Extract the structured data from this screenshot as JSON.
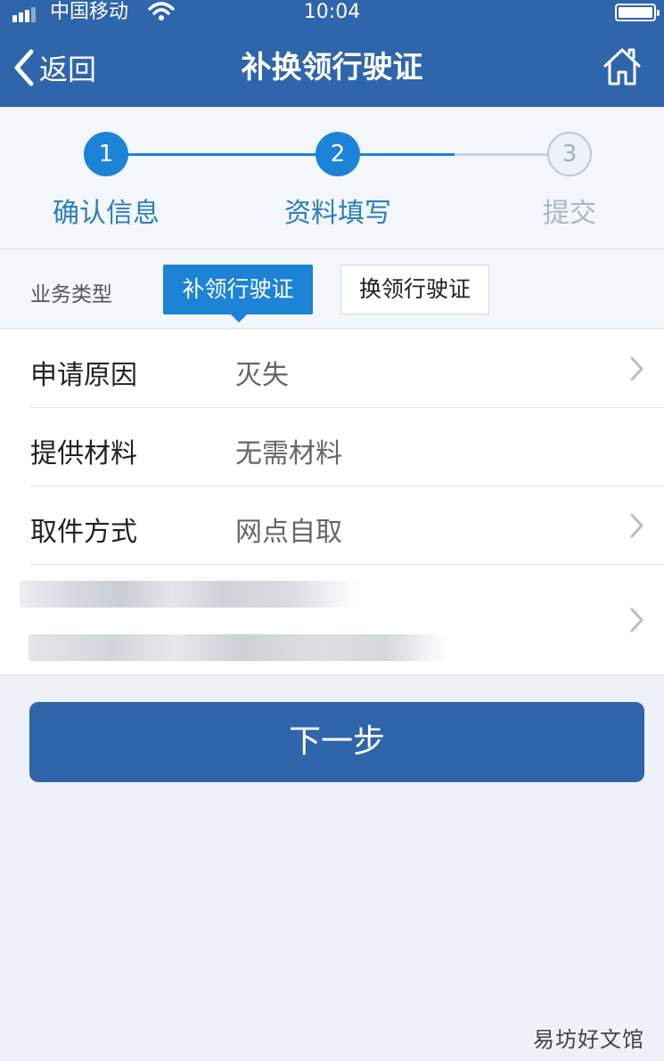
{
  "status_bar": {
    "carrier": "中国移动",
    "time": "10:04"
  },
  "nav": {
    "back_label": "返回",
    "title": "补换领行驶证"
  },
  "steps": [
    {
      "number": "1",
      "label": "确认信息",
      "state": "done"
    },
    {
      "number": "2",
      "label": "资料填写",
      "state": "current"
    },
    {
      "number": "3",
      "label": "提交",
      "state": "pending"
    }
  ],
  "business_type": {
    "label": "业务类型",
    "options": [
      "补领行驶证",
      "换领行驶证"
    ],
    "selected": "补领行驶证"
  },
  "form": {
    "rows": [
      {
        "label": "申请原因",
        "value": "灭失"
      },
      {
        "label": "提供材料",
        "value": "无需材料"
      },
      {
        "label": "取件方式",
        "value": "网点自取"
      }
    ]
  },
  "next_button": "下一步",
  "watermark": "易坊好文馆",
  "colors": {
    "nav": "#2f65aa",
    "accent": "#1c83d6",
    "background": "#eef2f8"
  }
}
